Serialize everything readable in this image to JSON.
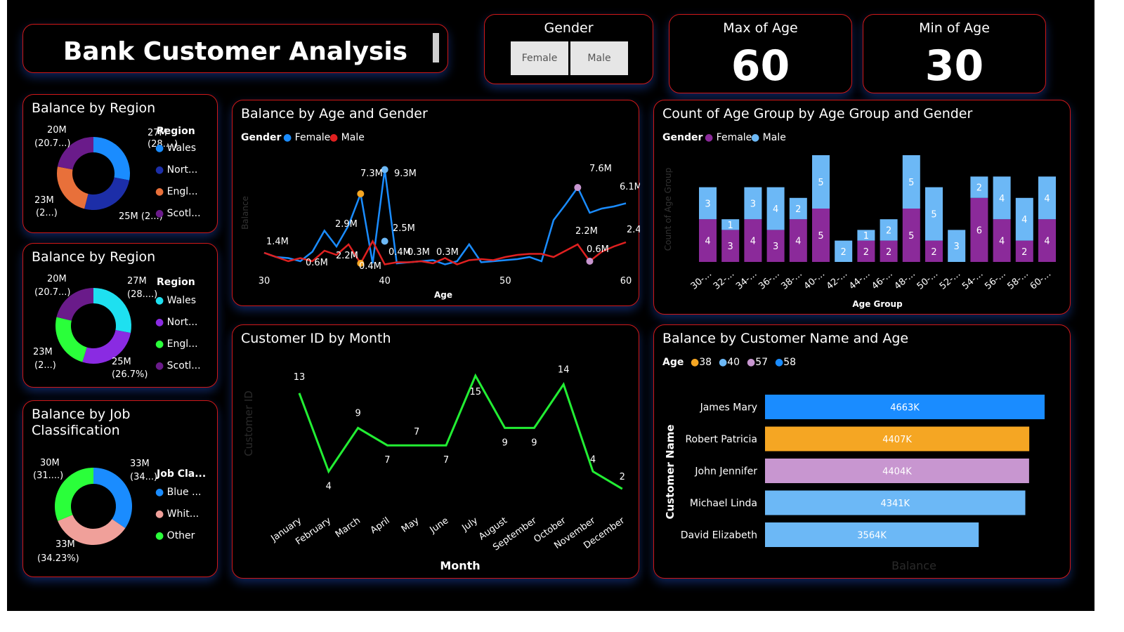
{
  "title": "Bank Customer Analysis",
  "gender_slicer": {
    "title": "Gender",
    "options": [
      "Female",
      "Male"
    ]
  },
  "kpi_max": {
    "label": "Max of Age",
    "value": "60"
  },
  "kpi_min": {
    "label": "Min of Age",
    "value": "30"
  },
  "region1": {
    "title": "Balance by Region",
    "legend_title": "Region",
    "legend": [
      "Wales",
      "Nort...",
      "Engl...",
      "Scotl..."
    ],
    "labels": {
      "tr_v": "27M",
      "tr_p": "(28....)",
      "br": "25M (2...)",
      "bl_v": "23M",
      "bl_p": "(2...)",
      "tl_v": "20M",
      "tl_p": "(20.7...)"
    },
    "colors": [
      "#1a8cff",
      "#1c2ea8",
      "#e8703a",
      "#6a1b8a"
    ]
  },
  "region2": {
    "title": "Balance by Region",
    "legend_title": "Region",
    "legend": [
      "Wales",
      "Nort...",
      "Engl...",
      "Scotl..."
    ],
    "labels": {
      "tr_v": "27M",
      "tr_p": "(28....)",
      "br_v": "25M",
      "br_p": "(26.7%)",
      "bl_v": "23M",
      "bl_p": "(2...)",
      "tl_v": "20M",
      "tl_p": "(20.7...)"
    },
    "colors": [
      "#1ee0f0",
      "#8a2be2",
      "#2aff3a",
      "#6a1b8a"
    ]
  },
  "job": {
    "title_line1": "Balance by Job",
    "title_line2": "Classification",
    "legend_title": "Job Cla...",
    "legend": [
      "Blue ...",
      "Whit...",
      "Other"
    ],
    "labels": {
      "tr_v": "33M",
      "tr_p": "(34...)",
      "bot_v": "33M",
      "bot_p": "(34.23%)",
      "tl_v": "30M",
      "tl_p": "(31....)"
    },
    "colors": [
      "#1a8cff",
      "#f0a09a",
      "#2aff3a"
    ]
  },
  "age_gender": {
    "title": "Balance by Age and Gender",
    "legend_title": "Gender",
    "legend": [
      "Female",
      "Male"
    ],
    "colors": [
      "#1a8cff",
      "#e02020"
    ],
    "xlabel": "Age",
    "ylabel": "Balance",
    "xticks": [
      "30",
      "40",
      "50",
      "60"
    ],
    "labels": [
      "1.4M",
      "0.6M",
      "2.9M",
      "2.2M",
      "7.3M",
      "9.3M",
      "0.4M",
      "0.4M",
      "2.5M",
      "0.3M",
      "0.3M",
      "7.6M",
      "6.1M",
      "2.2M",
      "0.6M",
      "2.4M"
    ]
  },
  "age_group": {
    "title": "Count of Age Group by Age Group and Gender",
    "legend_title": "Gender",
    "legend": [
      "Female",
      "Male"
    ],
    "colors": [
      "#8b2a9a",
      "#6cb8f6"
    ],
    "xlabel": "Age Group",
    "ylabel": "Count of Age Group",
    "categories": [
      "30-...",
      "32-...",
      "34-...",
      "36-...",
      "38-...",
      "40-...",
      "42-...",
      "44-...",
      "46-...",
      "48-...",
      "50-...",
      "52-...",
      "54-...",
      "56-...",
      "58-...",
      "60-..."
    ]
  },
  "month": {
    "title": "Customer ID by Month",
    "xlabel": "Month",
    "ylabel": "Customer ID",
    "color": "#22ee33",
    "months": [
      "January",
      "February",
      "March",
      "April",
      "May",
      "June",
      "July",
      "August",
      "September",
      "October",
      "November",
      "December"
    ],
    "values": [
      13,
      4,
      9,
      7,
      7,
      7,
      15,
      9,
      9,
      14,
      4,
      2
    ]
  },
  "customer": {
    "title": "Balance by Customer Name and Age",
    "legend_title": "Age",
    "legend": [
      "38",
      "40",
      "57",
      "58"
    ],
    "legend_colors": [
      "#f5a623",
      "#6cb8f6",
      "#c896d0",
      "#1a8cff"
    ],
    "ylabel": "Customer Name",
    "xlabel": "Balance",
    "names": [
      "James Mary",
      "Robert Patricia",
      "John Jennifer",
      "Michael Linda",
      "David Elizabeth"
    ],
    "labels": [
      "4663K",
      "4407K",
      "4404K",
      "4341K",
      "3564K"
    ]
  },
  "chart_data": [
    {
      "type": "line",
      "title": "Balance by Age and Gender",
      "xlabel": "Age",
      "ylabel": "Balance",
      "x": [
        30,
        31,
        32,
        33,
        34,
        35,
        36,
        37,
        38,
        39,
        40,
        41,
        42,
        43,
        44,
        45,
        46,
        47,
        48,
        49,
        50,
        51,
        52,
        53,
        54,
        55,
        56,
        57,
        58,
        59,
        60
      ],
      "series": [
        {
          "name": "Female",
          "values": [
            1.4,
            1.0,
            0.9,
            0.6,
            1.5,
            3.5,
            2.0,
            4.0,
            7.0,
            0.4,
            9.3,
            0.4,
            0.5,
            0.6,
            0.7,
            0.3,
            0.6,
            2.2,
            0.5,
            0.6,
            0.7,
            0.8,
            1.0,
            0.6,
            4.5,
            6.0,
            7.6,
            5.2,
            5.6,
            5.8,
            6.1
          ]
        },
        {
          "name": "Male",
          "values": [
            1.4,
            1.0,
            0.6,
            0.9,
            0.6,
            1.6,
            1.2,
            2.2,
            0.4,
            2.5,
            0.3,
            0.5,
            0.5,
            0.6,
            0.4,
            0.9,
            0.3,
            0.7,
            0.8,
            0.7,
            1.0,
            1.2,
            1.3,
            1.3,
            1.0,
            1.6,
            2.2,
            0.6,
            1.5,
            2.0,
            2.4
          ]
        }
      ],
      "ylim": [
        0,
        10
      ]
    },
    {
      "type": "bar",
      "title": "Count of Age Group by Age Group and Gender",
      "xlabel": "Age Group",
      "ylabel": "Count of Age Group",
      "categories": [
        "30-...",
        "32-...",
        "34-...",
        "36-...",
        "38-...",
        "40-...",
        "42-...",
        "44-...",
        "46-...",
        "48-...",
        "50-...",
        "52-...",
        "54-...",
        "56-...",
        "58-...",
        "60-..."
      ],
      "series": [
        {
          "name": "Female",
          "values": [
            4,
            3,
            4,
            3,
            4,
            5,
            0,
            2,
            2,
            5,
            2,
            0,
            6,
            4,
            2,
            4
          ]
        },
        {
          "name": "Male",
          "values": [
            3,
            1,
            3,
            4,
            2,
            5,
            2,
            1,
            2,
            5,
            5,
            3,
            2,
            4,
            4,
            4
          ]
        }
      ],
      "ylim": [
        0,
        13
      ]
    },
    {
      "type": "line",
      "title": "Customer ID by Month",
      "xlabel": "Month",
      "ylabel": "Customer ID",
      "categories": [
        "January",
        "February",
        "March",
        "April",
        "May",
        "June",
        "July",
        "August",
        "September",
        "October",
        "November",
        "December"
      ],
      "values": [
        13,
        4,
        9,
        7,
        7,
        7,
        15,
        9,
        9,
        14,
        4,
        2
      ],
      "ylim": [
        0,
        16
      ]
    },
    {
      "type": "bar",
      "orientation": "horizontal",
      "title": "Balance by Customer Name and Age",
      "xlabel": "Balance",
      "ylabel": "Customer Name",
      "categories": [
        "James Mary",
        "Robert Patricia",
        "John Jennifer",
        "Michael Linda",
        "David Elizabeth"
      ],
      "values": [
        4663,
        4407,
        4404,
        4341,
        3564
      ],
      "ages": [
        "58",
        "38",
        "57",
        "40",
        "40"
      ],
      "unit": "K"
    }
  ]
}
